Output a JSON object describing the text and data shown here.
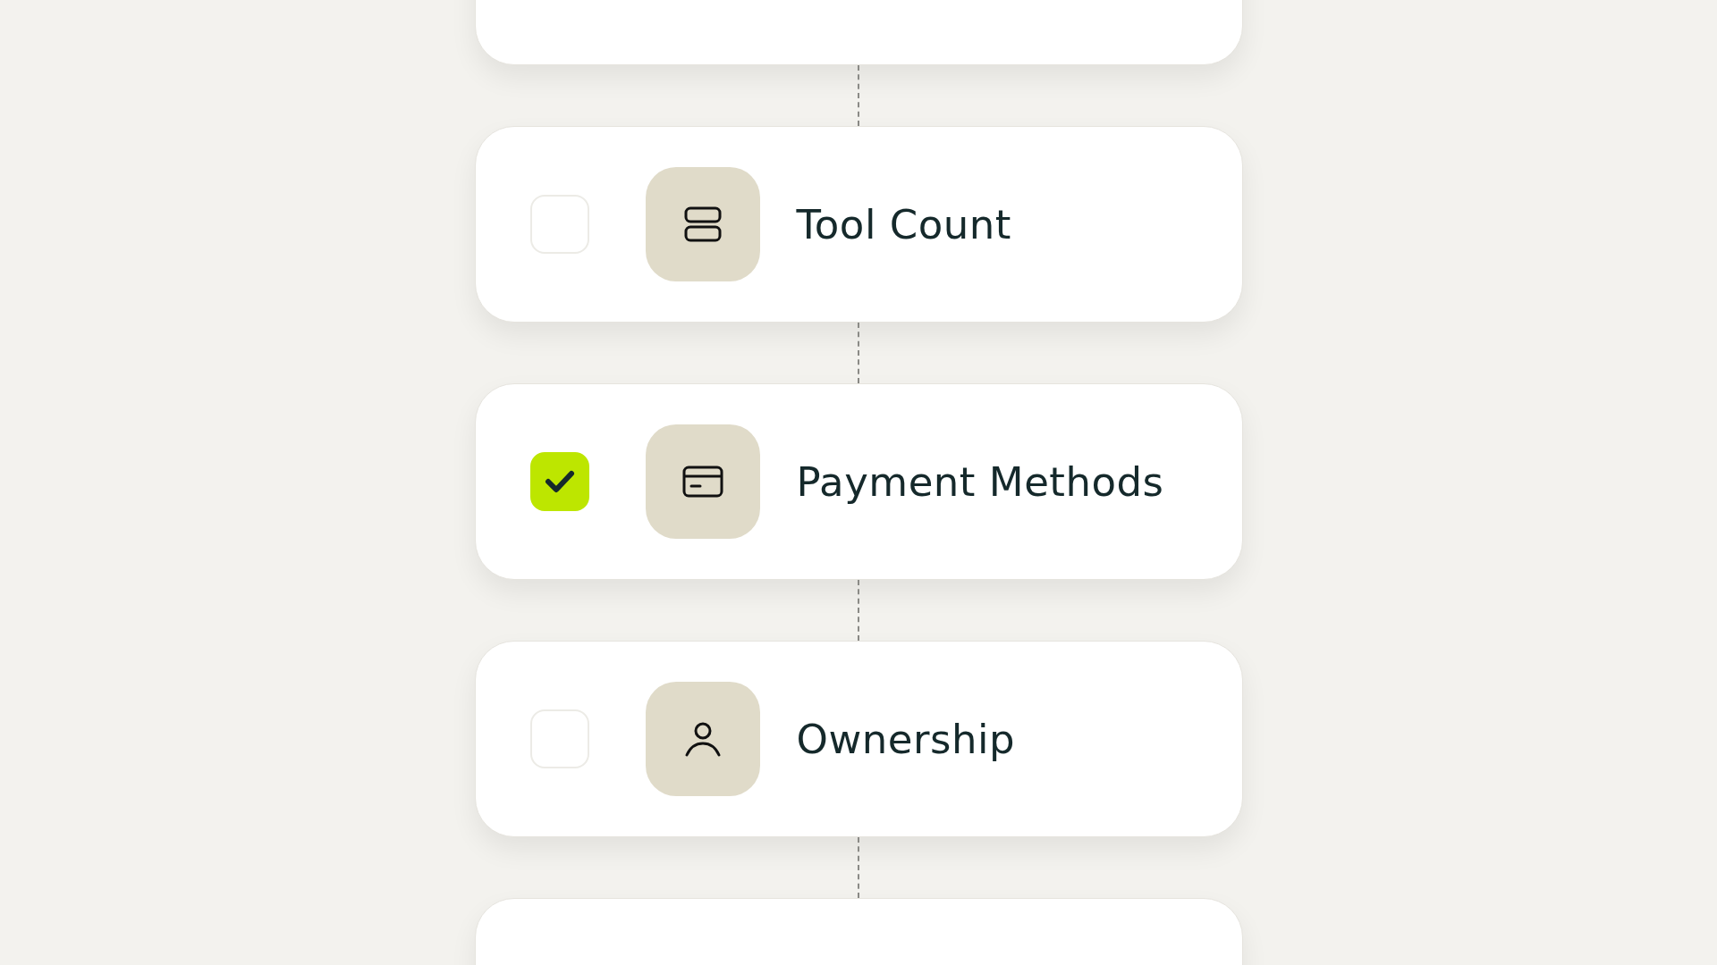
{
  "steps": [
    {
      "label": "Tool Count",
      "checked": false
    },
    {
      "label": "Payment Methods",
      "checked": true
    },
    {
      "label": "Ownership",
      "checked": false
    }
  ]
}
